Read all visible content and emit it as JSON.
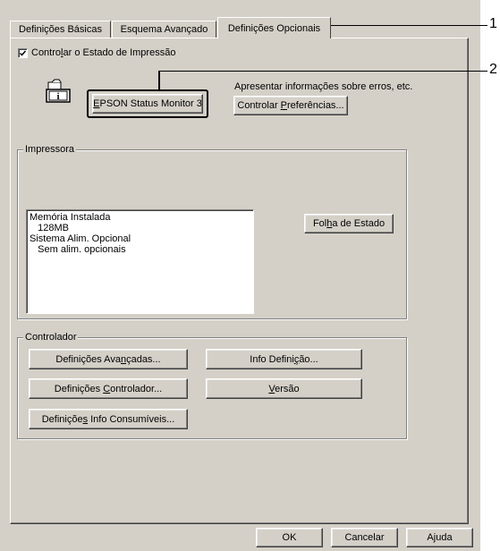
{
  "tabs": [
    {
      "label": "Definições Básicas"
    },
    {
      "label": "Esquema Avançado"
    },
    {
      "label": "Definições Opcionais"
    }
  ],
  "monitor_checkbox": {
    "pre": "Contro",
    "ul": "l",
    "post": "ar o Estado de Impressão",
    "checked": true
  },
  "status_monitor_button": {
    "pre": "",
    "ul": "E",
    "post": "PSON Status Monitor 3"
  },
  "info_text": "Apresentar informações sobre erros, etc.",
  "preferences_button": {
    "pre": "Controlar ",
    "ul": "P",
    "post": "referências..."
  },
  "printer_group": {
    "title": "Impressora",
    "list_lines": [
      "Memória Instalada",
      "   128MB",
      "Sistema Alim. Opcional",
      "   Sem alim. opcionais"
    ],
    "status_sheet_button": {
      "pre": "Fol",
      "ul": "h",
      "post": "a de Estado"
    }
  },
  "driver_group": {
    "title": "Controlador",
    "advanced_button": {
      "pre": "Definições Ava",
      "ul": "n",
      "post": "çadas..."
    },
    "driver_settings_button": {
      "pre": "Definições ",
      "ul": "C",
      "post": "ontrolador..."
    },
    "consumables_button": {
      "pre": "Definiçõe",
      "ul": "s",
      "post": " Info Consumíveis..."
    },
    "info_button": {
      "pre": "Info Defini",
      "ul": "ç",
      "post": "ão..."
    },
    "version_button": {
      "pre": "",
      "ul": "V",
      "post": "ersão"
    }
  },
  "footer": {
    "ok": "OK",
    "cancel": "Cancelar",
    "help": "Ajuda"
  },
  "callouts": [
    "1",
    "2"
  ]
}
